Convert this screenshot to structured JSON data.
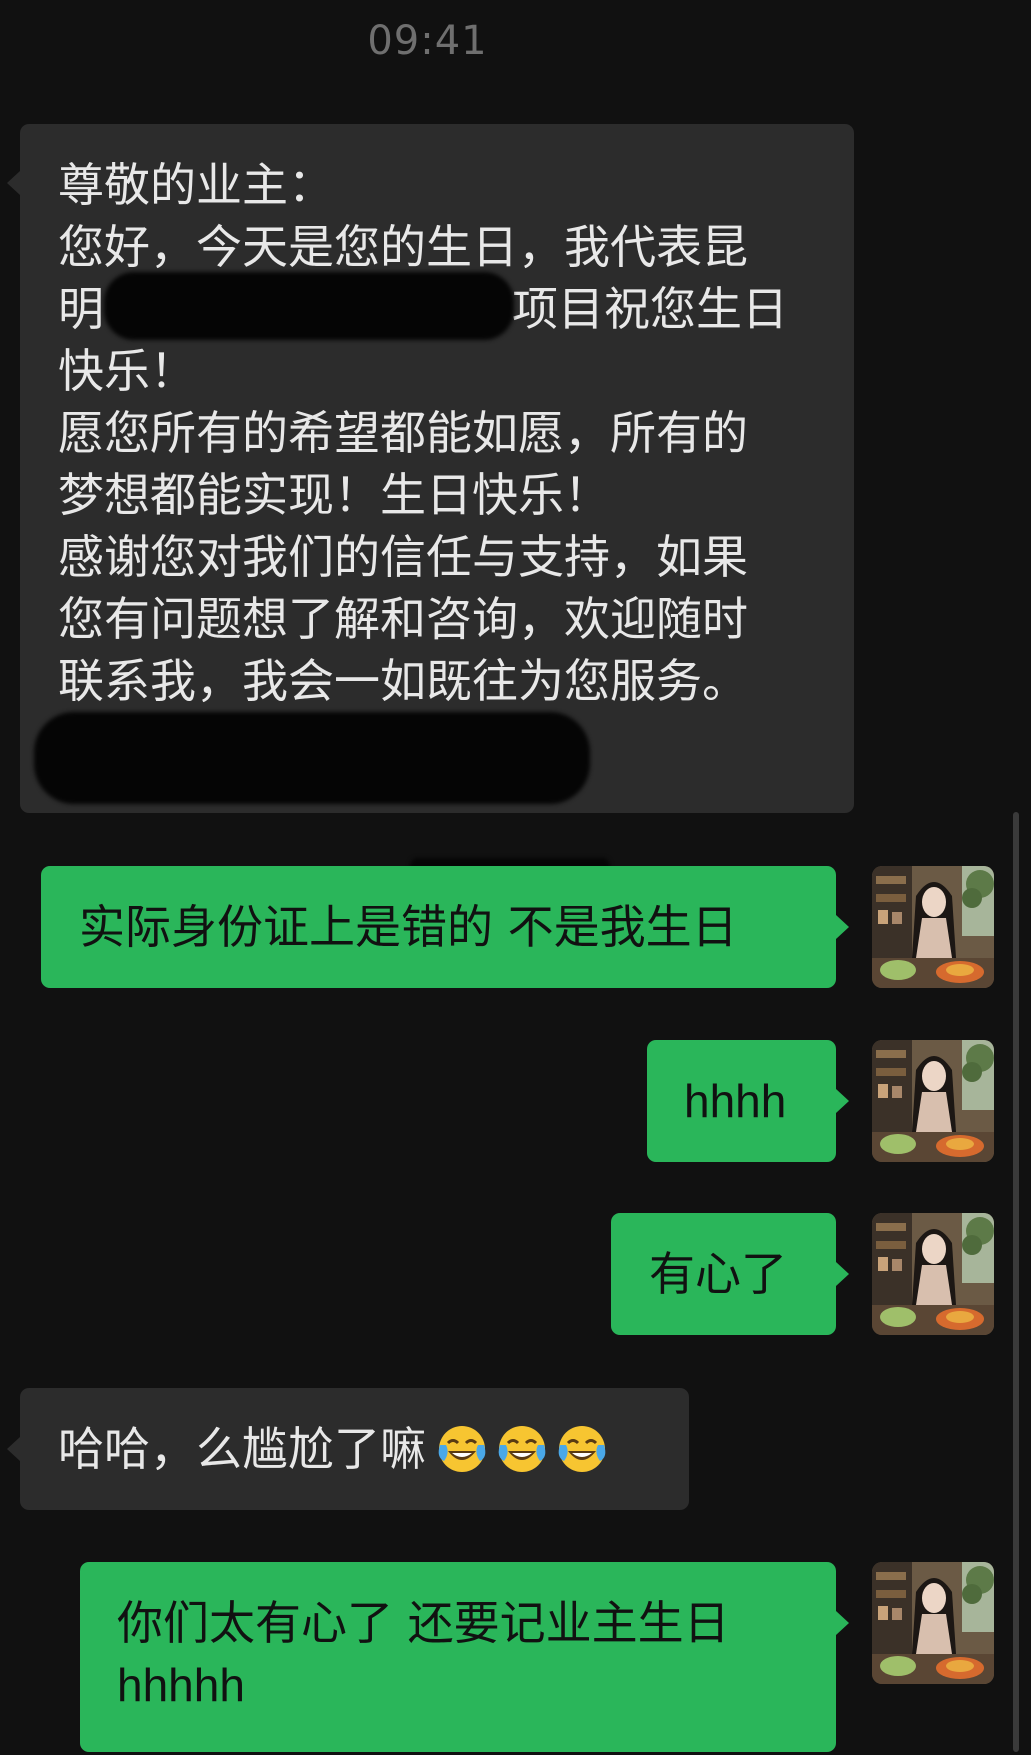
{
  "status": {
    "time": "09:41"
  },
  "messages": [
    {
      "direction": "in",
      "lines": [
        "尊敬的业主：",
        "您好，今天是您的生日，我代表昆",
        "明",
        "项目祝您生日",
        "快乐！",
        "愿您所有的希望都能如愿，所有的",
        "梦想都能实现！生日快乐！",
        "感谢您对我们的信任与支持，如果",
        "您有问题想了解和咨询，欢迎随时",
        "联系我，我会一如既往为您服务。"
      ]
    },
    {
      "direction": "out",
      "text": "实际身份证上是错的 不是我生日"
    },
    {
      "direction": "out",
      "text": "hhhh"
    },
    {
      "direction": "out",
      "text": "有心了"
    },
    {
      "direction": "in",
      "text": "哈哈，么尴尬了嘛",
      "emoji": "tears-of-joy-emoji"
    },
    {
      "direction": "out",
      "lines": [
        "你们太有心了 还要记业主生日",
        "hhhhh"
      ]
    }
  ],
  "avatar": {
    "icon": "user-avatar-photo"
  },
  "colors": {
    "background": "#111111",
    "incoming_bubble": "#2c2c2c",
    "outgoing_bubble": "#2ab65a",
    "timestamp": "#6f6f6f"
  }
}
